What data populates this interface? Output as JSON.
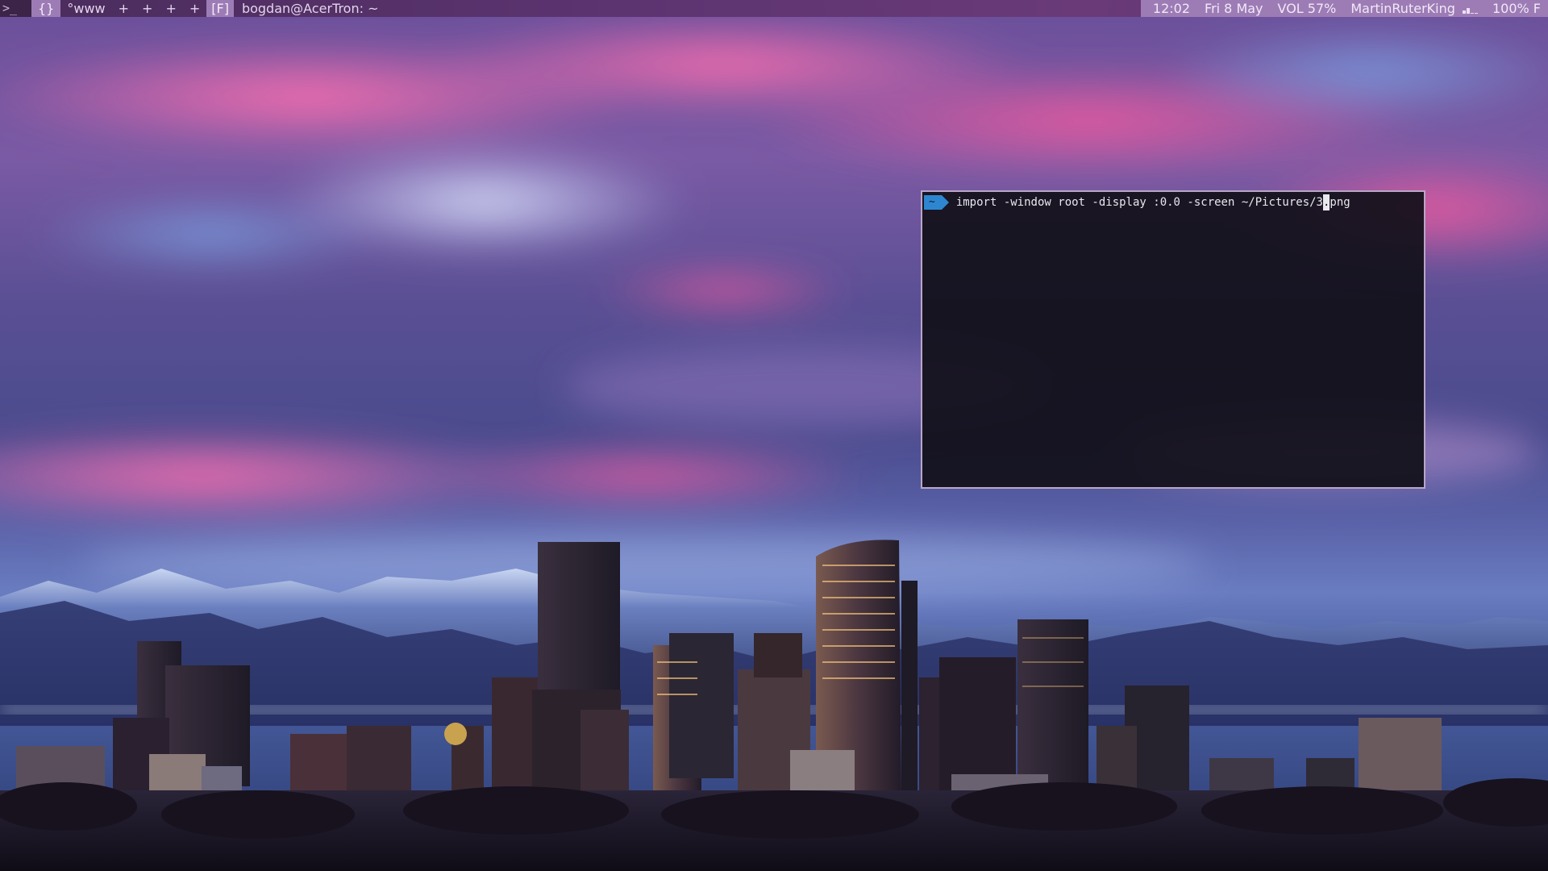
{
  "topbar": {
    "layout_icon": ">_",
    "workspaces": [
      {
        "label": "{}",
        "state": "normal"
      },
      {
        "label": "°www",
        "state": "normal"
      },
      {
        "label": "+",
        "state": "normal"
      },
      {
        "label": "+",
        "state": "normal"
      },
      {
        "label": "+",
        "state": "normal"
      },
      {
        "label": "+",
        "state": "normal"
      },
      {
        "label": "[F]",
        "state": "current"
      }
    ],
    "window_title": "bogdan@AcerTron: ~",
    "clock": "12:02",
    "date": "Fri 8 May",
    "volume": "VOL 57%",
    "wifi_name": "MartinRuterKing",
    "wifi_signal_bars": 2,
    "battery": "100% F"
  },
  "terminal": {
    "prompt_dir": "~",
    "command_before_cursor": "import -window root -display :0.0 -screen ~/Pictures/3",
    "cursor_char": ".",
    "command_after_cursor": "png"
  },
  "colors": {
    "topbar_bg": "#5c3470",
    "topbar_accent": "#9d7cb6",
    "terminal_bg": "#12101a",
    "terminal_border": "#b9a6c6",
    "prompt_accent": "#2f86d0"
  },
  "wallpaper": {
    "subject": "city skyline at dusk with snowy mountains and pink clouds"
  }
}
